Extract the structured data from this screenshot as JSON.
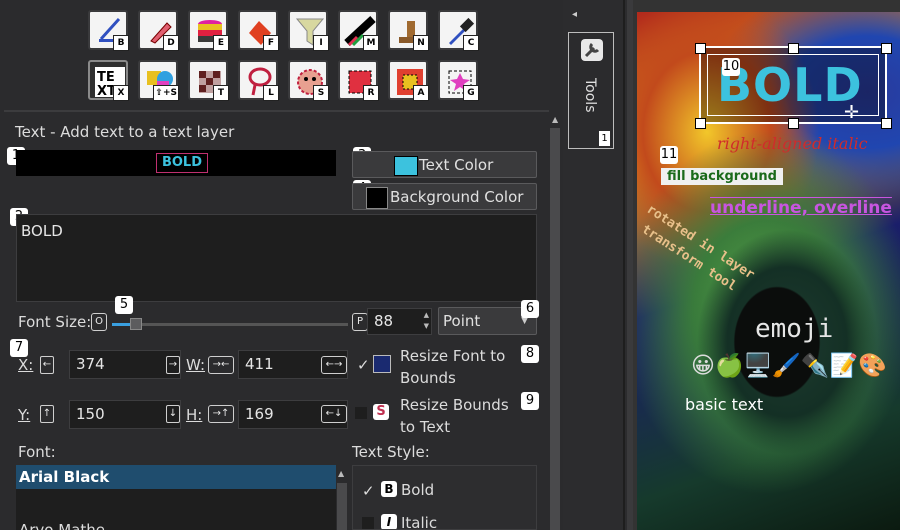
{
  "toolbar": {
    "row1": [
      {
        "name": "pen-tool",
        "sc": "B"
      },
      {
        "name": "pencil-tool",
        "sc": "D"
      },
      {
        "name": "layers-tool",
        "sc": "E"
      },
      {
        "name": "fill-tool",
        "sc": "F"
      },
      {
        "name": "filter-tool",
        "sc": "I"
      },
      {
        "name": "magic-brush-tool",
        "sc": "M"
      },
      {
        "name": "stamp-tool",
        "sc": "N"
      },
      {
        "name": "eyedropper-tool",
        "sc": "C"
      }
    ],
    "row2": [
      {
        "name": "text-tool",
        "sc": "X"
      },
      {
        "name": "shape-tool",
        "sc": "⇧+S"
      },
      {
        "name": "checker-tool",
        "sc": "T"
      },
      {
        "name": "lasso-tool",
        "sc": "L"
      },
      {
        "name": "face-select-tool",
        "sc": "S"
      },
      {
        "name": "rect-select-tool",
        "sc": "R"
      },
      {
        "name": "auto-select-tool",
        "sc": "A"
      },
      {
        "name": "gradient-tool",
        "sc": "G"
      }
    ]
  },
  "tool_title": "Text - Add text to a text layer",
  "preview_text": "BOLD",
  "text_color_label": "Text Color",
  "text_color": "#3cc2de",
  "bg_color_label": "Background Color",
  "bg_color": "#000000",
  "text_value": "BOLD",
  "font_size": {
    "label": "Font Size:",
    "min_key": "O",
    "max_key": "P",
    "value": "88",
    "unit": "Point",
    "level": 0.07
  },
  "x": {
    "label": "X:",
    "value": "374"
  },
  "y": {
    "label": "Y:",
    "value": "150"
  },
  "w": {
    "label": "W:",
    "value": "411"
  },
  "h": {
    "label": "H:",
    "value": "169"
  },
  "resize_font": {
    "label": "Resize Font to Bounds",
    "checked": "✓"
  },
  "resize_bounds": {
    "label": "Resize Bounds to Text"
  },
  "font_label": "Font:",
  "fonts": [
    "Arial Black",
    "Arvo Mathe"
  ],
  "text_style_label": "Text Style:",
  "styles": [
    {
      "label": "Bold",
      "checked": "✓",
      "glyph": "B"
    },
    {
      "label": "Italic",
      "checked": "",
      "glyph": "I"
    }
  ],
  "badges": [
    "1",
    "2",
    "3",
    "4",
    "5",
    "6",
    "7",
    "8",
    "9",
    "10",
    "11"
  ],
  "sidebar": {
    "label": "Tools",
    "count": "1",
    "collapse": "◂"
  },
  "canvas": {
    "bold": "BOLD",
    "right_italic": "right-aligned italic",
    "fill_bg": "fill background",
    "underline": "underline, overline",
    "rotated1": "rotated in layer",
    "rotated2": "transform tool",
    "emoji_label": "emoji",
    "emojis": "😀🍏🖥️🖌️✒️📝🎨",
    "basic": "basic text"
  }
}
